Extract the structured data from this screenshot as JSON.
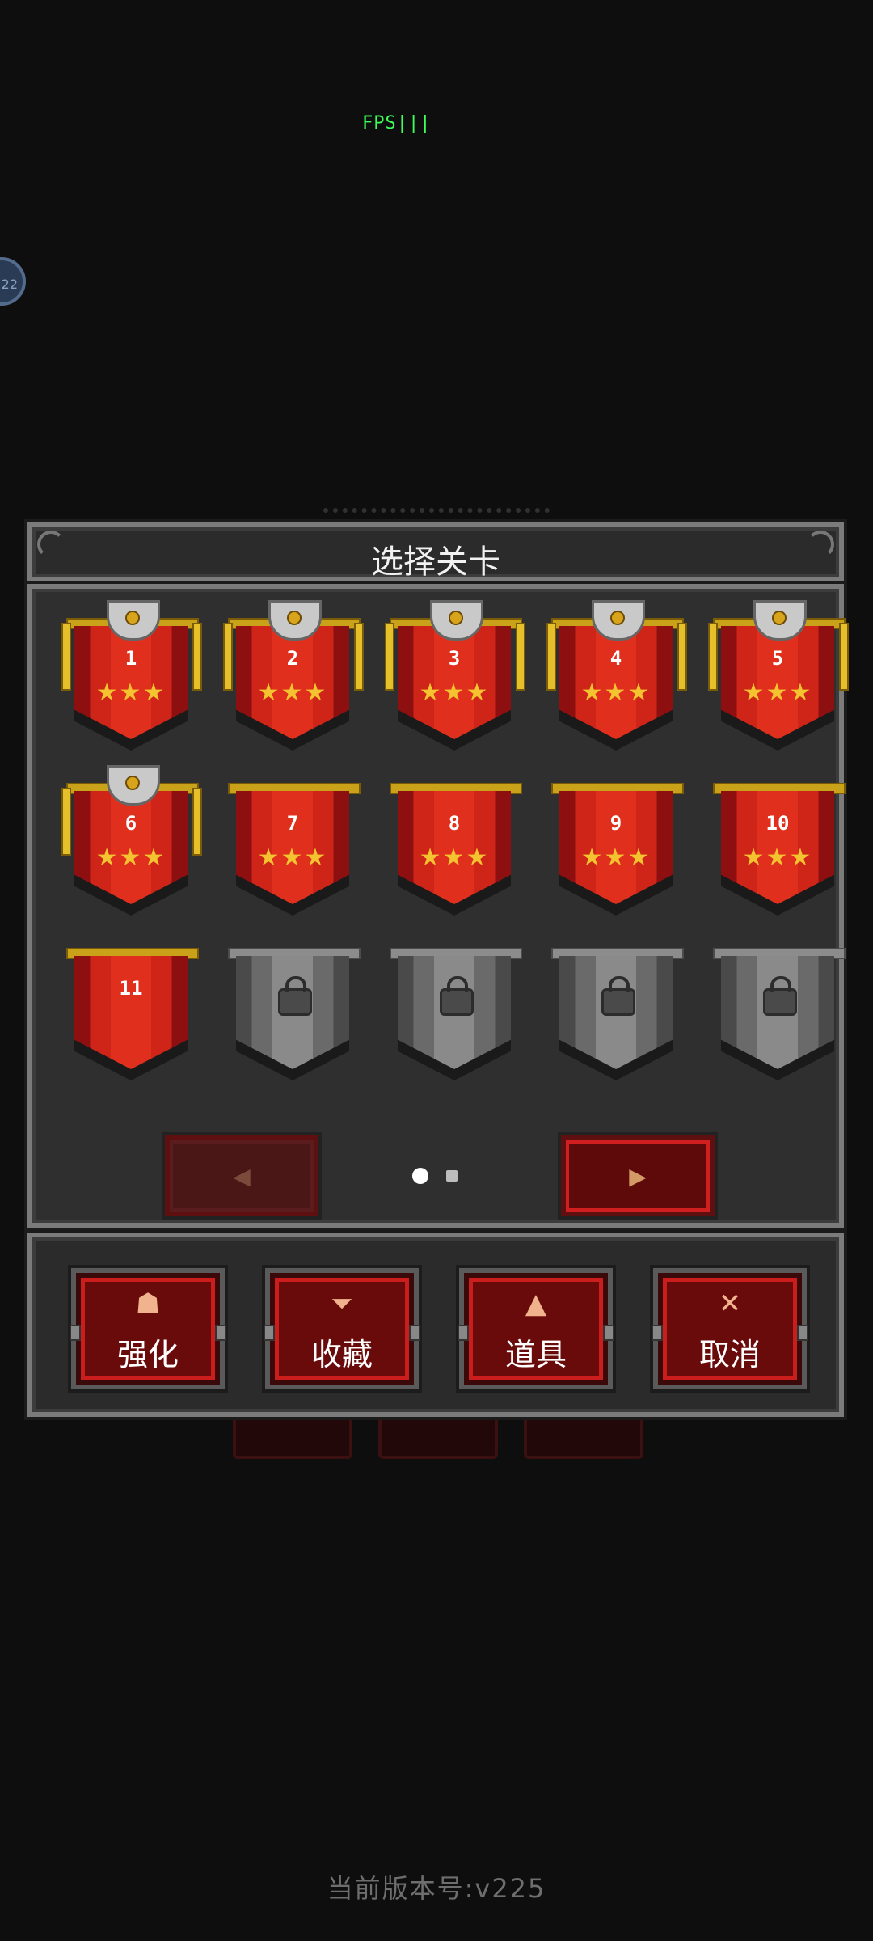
{
  "fps_label": "FPS|||",
  "side_badge": "22",
  "dialog": {
    "title": "选择关卡",
    "levels": [
      {
        "number": "1",
        "stars": "★★★",
        "crest": true,
        "locked": false
      },
      {
        "number": "2",
        "stars": "★★★",
        "crest": true,
        "locked": false
      },
      {
        "number": "3",
        "stars": "★★★",
        "crest": true,
        "locked": false
      },
      {
        "number": "4",
        "stars": "★★★",
        "crest": true,
        "locked": false
      },
      {
        "number": "5",
        "stars": "★★★",
        "crest": true,
        "locked": false
      },
      {
        "number": "6",
        "stars": "★★★",
        "crest": true,
        "locked": false
      },
      {
        "number": "7",
        "stars": "★★★",
        "crest": false,
        "locked": false
      },
      {
        "number": "8",
        "stars": "★★★",
        "crest": false,
        "locked": false
      },
      {
        "number": "9",
        "stars": "★★★",
        "crest": false,
        "locked": false
      },
      {
        "number": "10",
        "stars": "★★★",
        "crest": false,
        "locked": false
      },
      {
        "number": "11",
        "stars": "",
        "crest": false,
        "locked": false
      },
      {
        "number": "",
        "stars": "",
        "crest": false,
        "locked": true
      },
      {
        "number": "",
        "stars": "",
        "crest": false,
        "locked": true
      },
      {
        "number": "",
        "stars": "",
        "crest": false,
        "locked": true
      },
      {
        "number": "",
        "stars": "",
        "crest": false,
        "locked": true
      }
    ],
    "pagination": {
      "prev_icon": "◀",
      "next_icon": "▶",
      "pages": 2,
      "current_page": 1,
      "prev_enabled": false,
      "next_enabled": true
    },
    "actions": [
      {
        "label": "强化",
        "icon": "☗",
        "icon_name": "upgrade-icon"
      },
      {
        "label": "收藏",
        "icon": "⏷",
        "icon_name": "trophy-icon"
      },
      {
        "label": "道具",
        "icon": "▲",
        "icon_name": "potion-icon"
      },
      {
        "label": "取消",
        "icon": "✕",
        "icon_name": "close-icon"
      }
    ]
  },
  "version_text": "当前版本号:v225",
  "colors": {
    "accent_red": "#d11f1f",
    "star_gold": "#f4c430",
    "fps_green": "#3cff5c"
  }
}
